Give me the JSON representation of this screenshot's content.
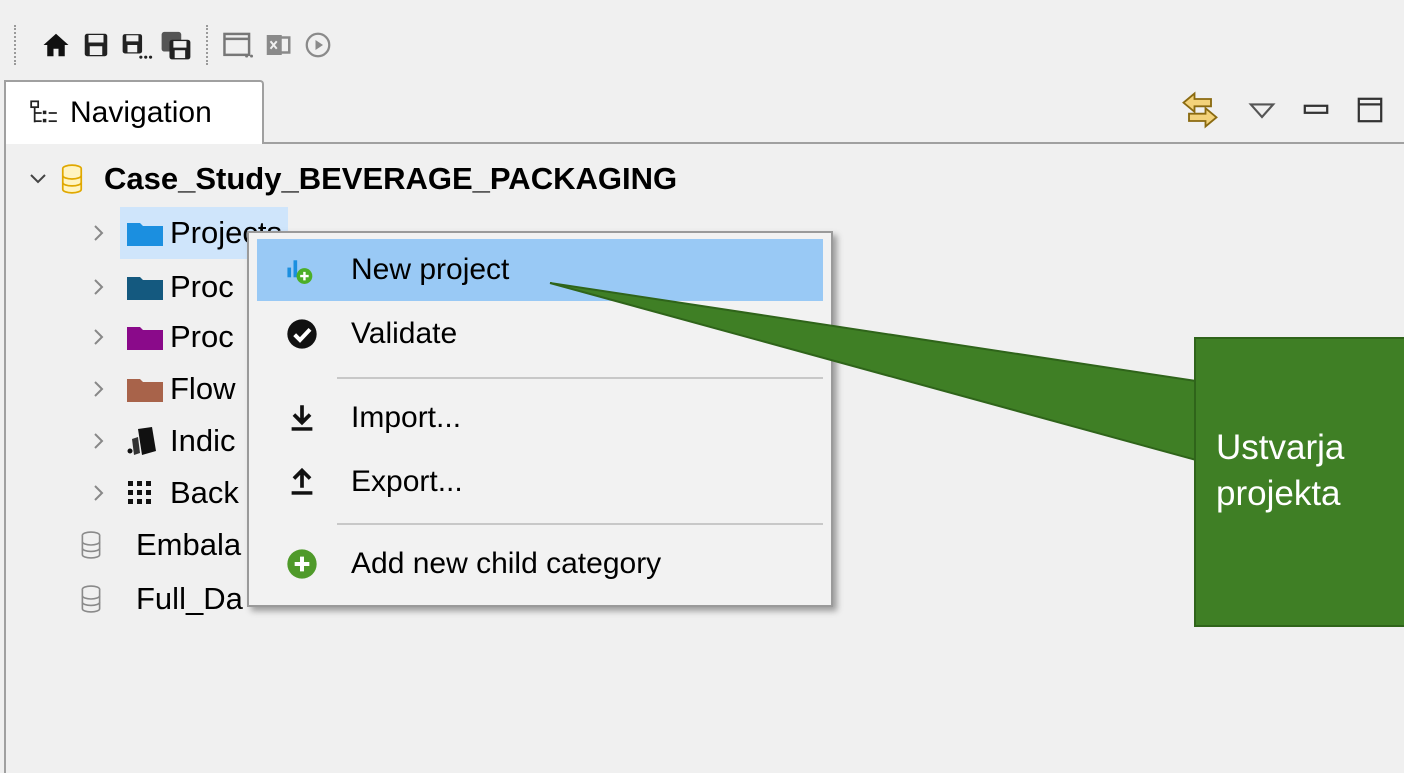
{
  "toolbar": {
    "items": [
      {
        "name": "home-icon"
      },
      {
        "name": "save-icon"
      },
      {
        "name": "save-as-icon"
      },
      {
        "name": "save-all-icon"
      },
      {
        "name": "window-icon"
      },
      {
        "name": "export-excel-icon"
      },
      {
        "name": "run-icon"
      }
    ]
  },
  "view": {
    "tab_label": "Navigation",
    "tab_icon": "tree-view-icon",
    "actions": [
      "link-with-editor-icon",
      "view-menu-icon",
      "minimize-icon",
      "maximize-icon"
    ]
  },
  "tree": {
    "root": {
      "label": "Case_Study_BEVERAGE_PACKAGING",
      "icon": "database-icon",
      "expanded": true
    },
    "children": [
      {
        "label": "Projects",
        "icon": "folder-icon",
        "color": "#1b8fe0",
        "selected": true
      },
      {
        "label": "Proc",
        "icon": "folder-icon",
        "color": "#14597f"
      },
      {
        "label": "Proc",
        "icon": "folder-icon",
        "color": "#8a0a8a"
      },
      {
        "label": "Flow",
        "icon": "folder-icon",
        "color": "#a8634a"
      },
      {
        "label": "Indic",
        "icon": "indicator-icon",
        "color": "#111111"
      },
      {
        "label": "Back",
        "icon": "grid-icon",
        "color": "#111111"
      }
    ],
    "databases": [
      {
        "label": "Embala",
        "icon": "database-icon"
      },
      {
        "label": "Full_Da",
        "icon": "database-icon"
      }
    ]
  },
  "context_menu": {
    "items": [
      {
        "label": "New project",
        "icon": "new-project-icon",
        "highlighted": true
      },
      {
        "label": "Validate",
        "icon": "check-icon"
      },
      {
        "label": "Import...",
        "icon": "import-icon"
      },
      {
        "label": "Export...",
        "icon": "export-icon"
      },
      {
        "label": "Add new child category",
        "icon": "add-circle-icon"
      }
    ]
  },
  "callout": {
    "line1": "Ustvarja",
    "line2": "projekta",
    "color": "#3f7f25"
  }
}
